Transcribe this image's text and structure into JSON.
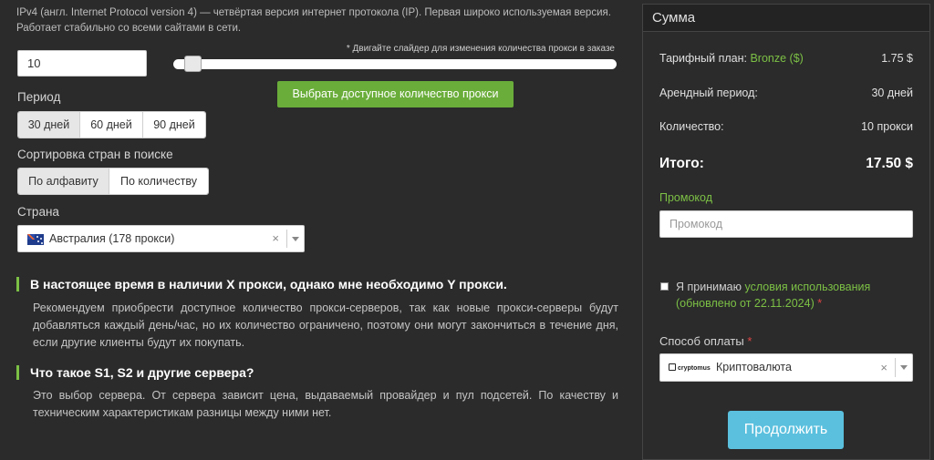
{
  "intro": {
    "line1": "IPv4 (англ. Internet Protocol version 4) — четвёртая версия интернет протокола (IP). Первая широко используемая версия.",
    "line2": "Работает стабильно со всеми сайтами в сети."
  },
  "quantity": {
    "value": "10",
    "slider_hint": "* Двигайте слайдер для изменения количества прокси в заказе",
    "slider_level": 0.03
  },
  "pick_button": "Выбрать доступное количество прокси",
  "period": {
    "label": "Период",
    "options": [
      "30 дней",
      "60 дней",
      "90 дней"
    ],
    "selected": "30 дней"
  },
  "sort": {
    "label": "Сортировка стран в поиске",
    "options": [
      "По алфавиту",
      "По количеству"
    ],
    "selected": "По алфавиту"
  },
  "country": {
    "label": "Страна",
    "value": "Австралия (178 прокси)",
    "clear": "×",
    "flag_icon": "australia-flag-icon"
  },
  "faq": [
    {
      "title": "В настоящее время в наличии X прокси, однако мне необходимо Y прокси.",
      "text": "Рекомендуем приобрести доступное количество прокси-серверов, так как новые прокси-серверы будут добавляться каждый день/час, но их количество ограничено, поэтому они могут закончиться в течение дня, если другие клиенты будут их покупать."
    },
    {
      "title": "Что такое S1, S2 и другие сервера?",
      "text": "Это выбор сервера. От сервера зависит цена, выдаваемый провайдер и пул подсетей. По качеству и техническим характеристикам разницы между ними нет."
    }
  ],
  "summary": {
    "title": "Сумма",
    "plan_label": "Тарифный план:",
    "plan_name": "Bronze ($)",
    "plan_price": "1.75 $",
    "period_label": "Арендный период:",
    "period_value": "30 дней",
    "qty_label": "Количество:",
    "qty_value": "10 прокси",
    "total_label": "Итого:",
    "total_value": "17.50 $",
    "promo_label": "Промокод",
    "promo_placeholder": "Промокод",
    "agree_prefix": "Я принимаю",
    "agree_link": "условия использования (обновлено от 22.11.2024)",
    "agree_star": "*",
    "pay_label": "Способ оплаты",
    "pay_star": "*",
    "pay_logo": "cryptomus",
    "pay_value": "Криптовалюта",
    "pay_clear": "×",
    "continue_button": "Продолжить"
  },
  "colors": {
    "accent_green": "#6aad3a",
    "link_green": "#7cc045",
    "continue_blue": "#5bc0de",
    "required_red": "#e04545"
  }
}
